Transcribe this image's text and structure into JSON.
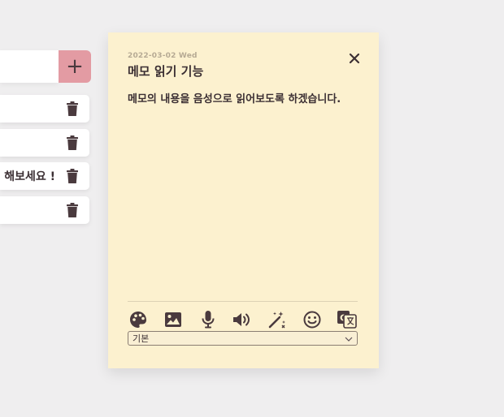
{
  "memo_list": {
    "add_button_label": "+",
    "items": [
      {
        "text": ""
      },
      {
        "text": ""
      },
      {
        "text": "해보세요 !"
      },
      {
        "text": ""
      }
    ]
  },
  "memo": {
    "date": "2022-03-02 Wed",
    "title": "메모 읽기 기능",
    "body": "메모의 내용을 음성으로 읽어보도록 하겠습니다.",
    "close_label": "✕"
  },
  "toolbar": {
    "tools": [
      "palette-icon",
      "image-icon",
      "microphone-icon",
      "speaker-icon",
      "magic-wand-icon",
      "smiley-icon",
      "translate-icon"
    ]
  },
  "font_select": {
    "selected": "기본"
  },
  "colors": {
    "background": "#efeeef",
    "card": "#fcf1cf",
    "accent": "#e39ba3",
    "icon": "#4a3a3e"
  }
}
